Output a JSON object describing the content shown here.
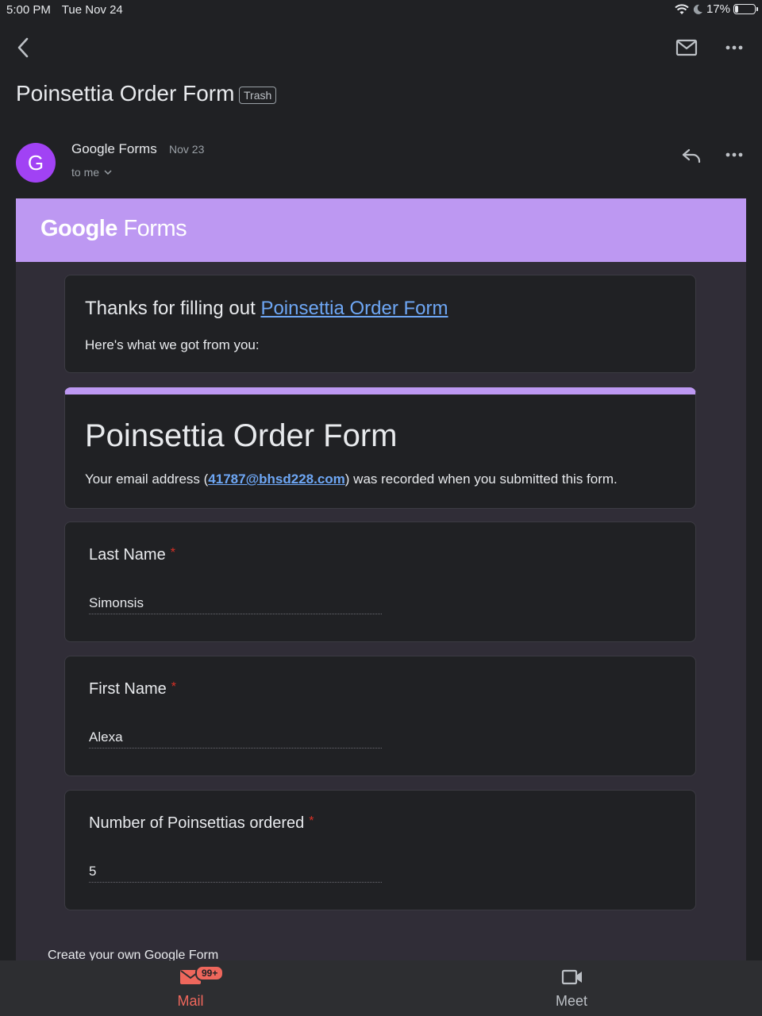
{
  "status_bar": {
    "time": "5:00 PM",
    "date": "Tue Nov 24",
    "battery": "17%",
    "battery_level": 0.17
  },
  "toolbar": {
    "back_icon": "back-chevron-icon",
    "mark_unread_icon": "mail-icon",
    "more_icon": "more-horizontal-icon"
  },
  "email": {
    "subject": "Poinsettia Order Form",
    "label": "Trash",
    "sender_initial": "G",
    "sender": "Google Forms",
    "date": "Nov 23",
    "recipient": "to me",
    "reply_icon": "reply-icon"
  },
  "body": {
    "logo_google": "Google",
    "logo_forms": "Forms",
    "thanks_prefix": "Thanks for filling out ",
    "thanks_link": "Poinsettia Order Form",
    "got_text": "Here's what we got from you:",
    "form_title": "Poinsettia Order Form",
    "email_prefix": "Your email address (",
    "email_address": "41787@bhsd228.com",
    "email_suffix": ") was recorded when you submitted this form.",
    "questions": [
      {
        "label": "Last Name",
        "required": "*",
        "answer": "Simonsis"
      },
      {
        "label": "First Name",
        "required": "*",
        "answer": "Alexa"
      },
      {
        "label": "Number of Poinsettias ordered",
        "required": "*",
        "answer": "5"
      }
    ],
    "footer_link": "Create your own Google Form"
  },
  "tabbar": {
    "mail_label": "Mail",
    "mail_badge": "99+",
    "meet_label": "Meet"
  },
  "colors": {
    "accent_purple": "#bd98f2",
    "link_blue": "#6ea7f5",
    "mail_active": "#ee675c",
    "avatar": "#a142f4"
  }
}
